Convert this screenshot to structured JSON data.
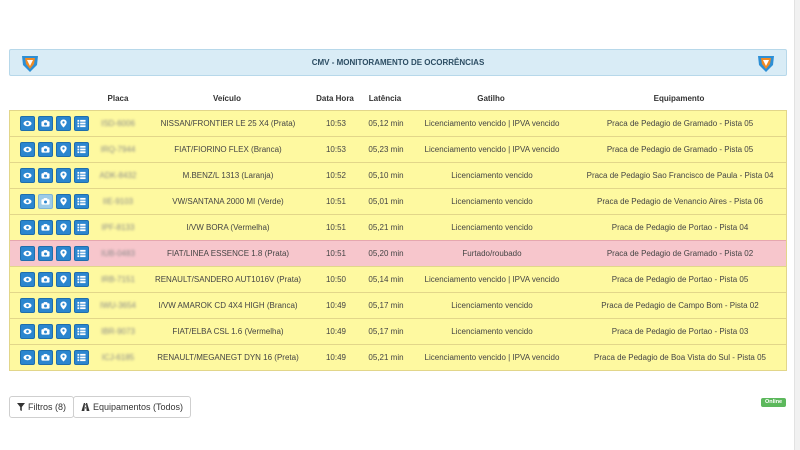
{
  "header": {
    "title": "CMV - MONITORAMENTO DE OCORRÊNCIAS"
  },
  "columns": {
    "placa": "Placa",
    "veiculo": "Veículo",
    "data_hora": "Data Hora",
    "latencia": "Latência",
    "gatilho": "Gatilho",
    "equipamento": "Equipamento"
  },
  "rows": [
    {
      "placa": "ISD-6006",
      "veiculo": "NISSAN/FRONTIER LE 25 X4 (Prata)",
      "hora": "10:53",
      "latencia": "05,12 min",
      "gatilho": "Licenciamento vencido | IPVA vencido",
      "equipamento": "Praca de Pedagio de Gramado - Pista 05",
      "status": "yellow"
    },
    {
      "placa": "IRQ-7944",
      "veiculo": "FIAT/FIORINO FLEX (Branca)",
      "hora": "10:53",
      "latencia": "05,23 min",
      "gatilho": "Licenciamento vencido | IPVA vencido",
      "equipamento": "Praca de Pedagio de Gramado - Pista 05",
      "status": "yellow"
    },
    {
      "placa": "ADK-8432",
      "veiculo": "M.BENZ/L 1313 (Laranja)",
      "hora": "10:52",
      "latencia": "05,10 min",
      "gatilho": "Licenciamento vencido",
      "equipamento": "Praca de Pedagio Sao Francisco de Paula - Pista 04",
      "status": "yellow"
    },
    {
      "placa": "IIE-9103",
      "veiculo": "VW/SANTANA 2000 MI (Verde)",
      "hora": "10:51",
      "latencia": "05,01 min",
      "gatilho": "Licenciamento vencido",
      "equipamento": "Praca de Pedagio de Venancio Aires - Pista 06",
      "status": "yellow"
    },
    {
      "placa": "IPF-8133",
      "veiculo": "I/VW BORA (Vermelha)",
      "hora": "10:51",
      "latencia": "05,21 min",
      "gatilho": "Licenciamento vencido",
      "equipamento": "Praca de Pedagio de Portao - Pista 04",
      "status": "yellow"
    },
    {
      "placa": "IUB-0483",
      "veiculo": "FIAT/LINEA ESSENCE 1.8 (Prata)",
      "hora": "10:51",
      "latencia": "05,20 min",
      "gatilho": "Furtado/roubado",
      "equipamento": "Praca de Pedagio de Gramado - Pista 02",
      "status": "red"
    },
    {
      "placa": "IRB-7151",
      "veiculo": "RENAULT/SANDERO AUT1016V (Prata)",
      "hora": "10:50",
      "latencia": "05,14 min",
      "gatilho": "Licenciamento vencido | IPVA vencido",
      "equipamento": "Praca de Pedagio de Portao - Pista 05",
      "status": "yellow"
    },
    {
      "placa": "IWU-3654",
      "veiculo": "I/VW AMAROK CD 4X4 HIGH (Branca)",
      "hora": "10:49",
      "latencia": "05,17 min",
      "gatilho": "Licenciamento vencido",
      "equipamento": "Praca de Pedagio de Campo Bom - Pista 02",
      "status": "yellow"
    },
    {
      "placa": "IBR-9073",
      "veiculo": "FIAT/ELBA CSL 1.6 (Vermelha)",
      "hora": "10:49",
      "latencia": "05,17 min",
      "gatilho": "Licenciamento vencido",
      "equipamento": "Praca de Pedagio de Portao - Pista 03",
      "status": "yellow"
    },
    {
      "placa": "ICJ-6185",
      "veiculo": "RENAULT/MEGANEGT DYN 16 (Preta)",
      "hora": "10:49",
      "latencia": "05,21 min",
      "gatilho": "Licenciamento vencido | IPVA vencido",
      "equipamento": "Praca de Pedagio de Boa Vista do Sul - Pista 05",
      "status": "yellow"
    }
  ],
  "row_actions": [
    "eye-icon",
    "camera-icon",
    "map-pin-icon",
    "list-icon"
  ],
  "footer": {
    "filters_label": "Filtros (8)",
    "equipment_label": "Equipamentos (Todos)",
    "status_badge": "Online"
  },
  "colors": {
    "header_bg": "#d9ecf6",
    "row_yellow": "#fef9a0",
    "row_red": "#f7c6cc",
    "button_blue": "#2b86cf",
    "online_green": "#5cb85c"
  }
}
